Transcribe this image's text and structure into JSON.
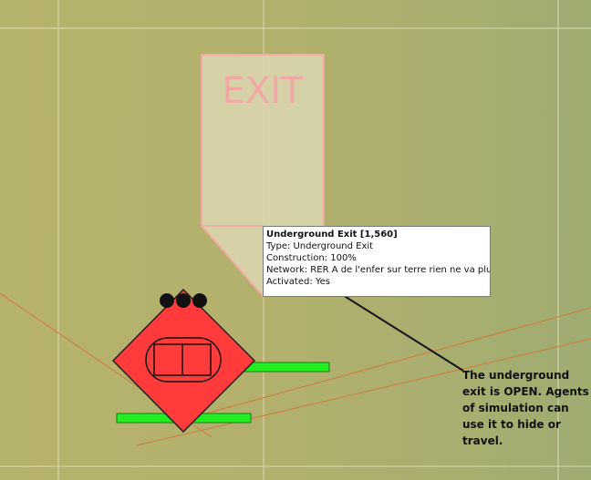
{
  "map": {
    "exit_sign_label": "EXIT",
    "colors": {
      "background": "#b5b26e",
      "grid_line": "#e2dfb6",
      "road_line": "#d07a3a",
      "sign_fill": "#dcd7b0",
      "sign_border": "#f0a8a4",
      "station_fill": "#ff3b3b",
      "platform_bar": "#22ee22"
    }
  },
  "tooltip": {
    "title": "Underground Exit [1,560]",
    "type": "Type: Underground Exit",
    "construction": "Construction: 100%",
    "network": "Network: RER A de l'enfer sur terre rien ne va plus",
    "activated": "Activated: Yes"
  },
  "annotation": {
    "text": "The underground exit is OPEN. Agents of simulation can use it to hide or travel."
  }
}
